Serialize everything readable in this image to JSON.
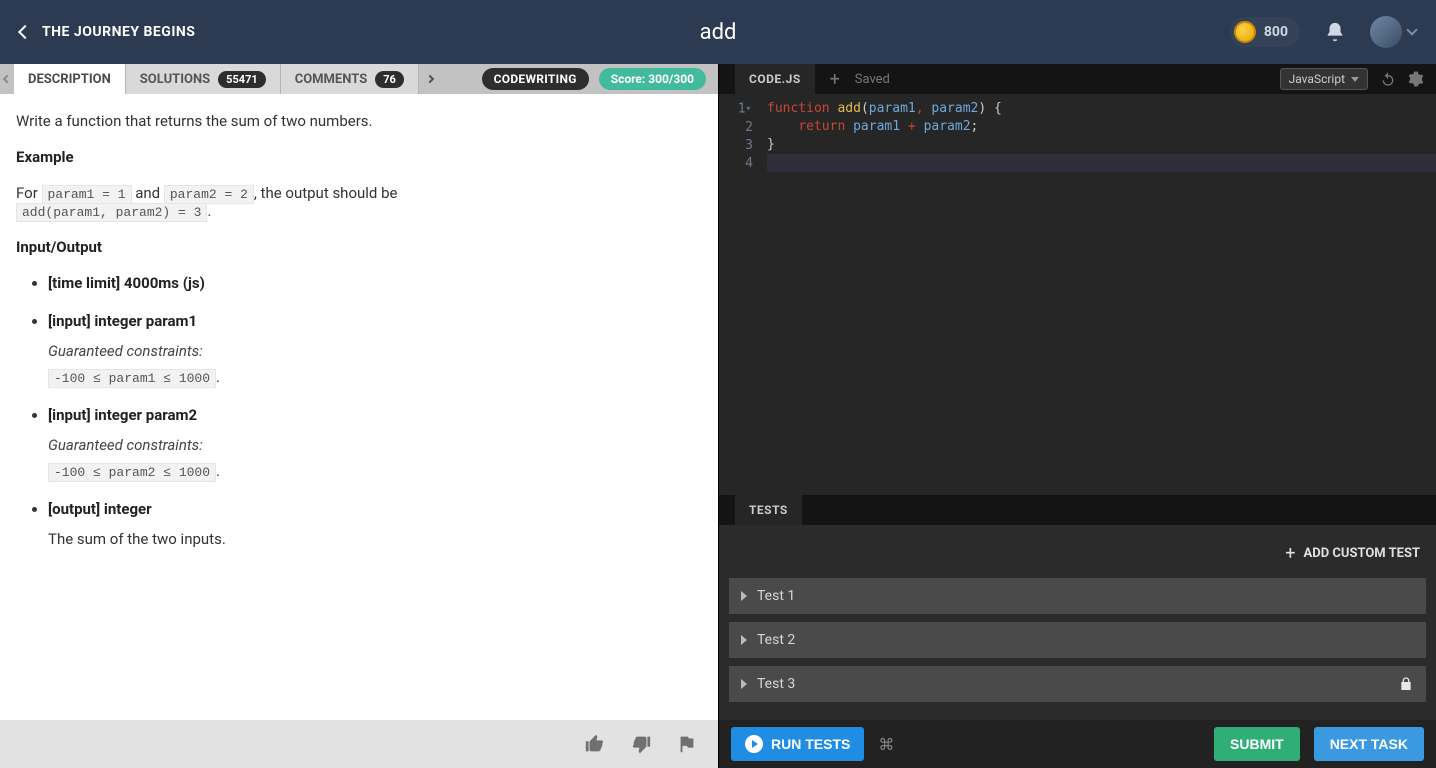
{
  "header": {
    "journey_title": "THE JOURNEY BEGINS",
    "task_title": "add",
    "coins": "800"
  },
  "tabs": {
    "description": "DESCRIPTION",
    "solutions": "SOLUTIONS",
    "solutions_count": "55471",
    "comments": "COMMENTS",
    "comments_count": "76",
    "codewriting": "CODEWRITING",
    "score": "Score: 300/300"
  },
  "description": {
    "intro": "Write a function that returns the sum of two numbers.",
    "example_heading": "Example",
    "example_prefix": "For ",
    "example_code1": "param1 = 1",
    "example_and": " and ",
    "example_code2": "param2 = 2",
    "example_suffix": ", the output should be",
    "example_result": "add(param1, param2) = 3",
    "io_heading": "Input/Output",
    "time_limit": "[time limit] 4000ms (js)",
    "input1": "[input] integer param1",
    "constraints_label1": "Guaranteed constraints:",
    "constraints_code1": "-100 ≤ param1 ≤ 1000",
    "input2": "[input] integer param2",
    "constraints_label2": "Guaranteed constraints:",
    "constraints_code2": "-100 ≤ param2 ≤ 1000",
    "output": "[output] integer",
    "output_desc": "The sum of the two inputs."
  },
  "code": {
    "filename": "CODE.JS",
    "saved": "Saved",
    "language": "JavaScript",
    "lines": {
      "l1_kw": "function",
      "l1_fn": "add",
      "l1_p1": "param1",
      "l1_p2": "param2",
      "l2_ret": "return",
      "l2_p1": "param1",
      "l2_p2": "param2"
    }
  },
  "tests": {
    "tab": "TESTS",
    "add_custom": "ADD CUSTOM TEST",
    "items": [
      "Test 1",
      "Test 2",
      "Test 3"
    ]
  },
  "buttons": {
    "run": "RUN TESTS",
    "submit": "SUBMIT",
    "next": "NEXT TASK"
  }
}
